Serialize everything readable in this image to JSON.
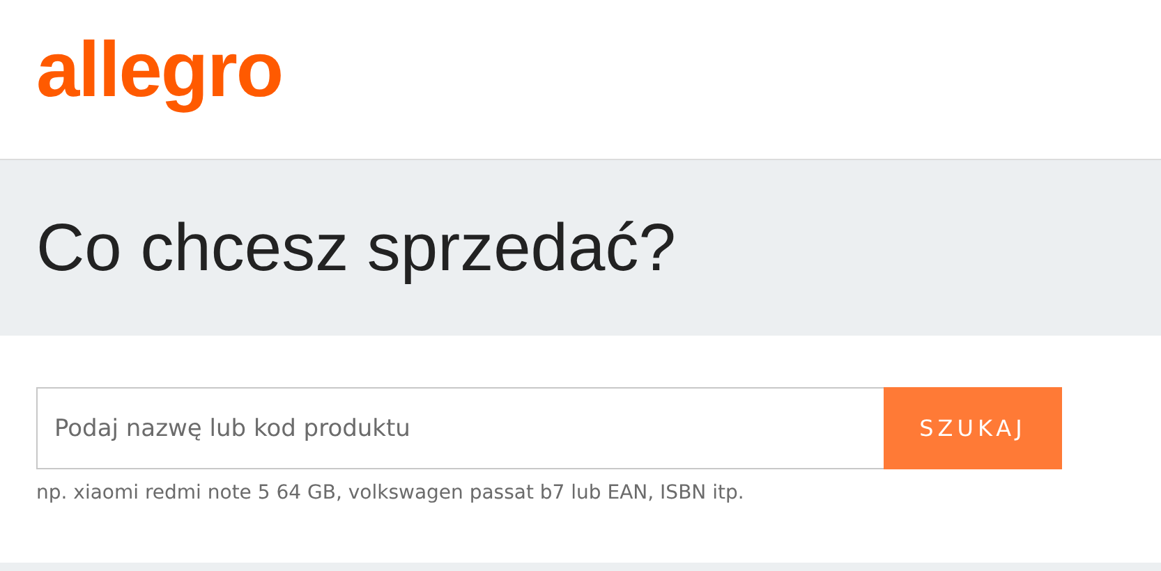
{
  "header": {
    "logo": "allegro"
  },
  "banner": {
    "heading": "Co chcesz sprzedać?"
  },
  "search": {
    "placeholder": "Podaj nazwę lub kod produktu",
    "button": "SZUKAJ",
    "hint": "np. xiaomi redmi note 5 64 GB, volkswagen passat b7 lub EAN, ISBN itp."
  }
}
